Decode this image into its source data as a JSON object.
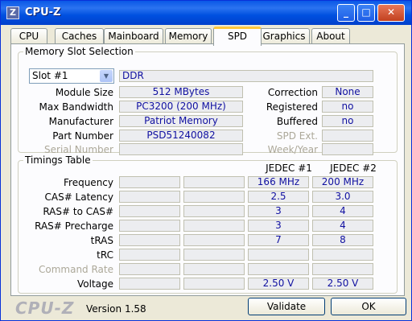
{
  "window": {
    "title": "CPU-Z",
    "app_icon_glyph": "Z"
  },
  "titlebar_buttons": {
    "minimize": "_",
    "maximize": "□",
    "close": "✕"
  },
  "tabs": [
    "CPU",
    "Caches",
    "Mainboard",
    "Memory",
    "SPD",
    "Graphics",
    "About"
  ],
  "active_tab": "SPD",
  "slot_group": {
    "title": "Memory Slot Selection",
    "slot_value": "Slot #1",
    "type_value": "DDR",
    "rows": [
      {
        "label": "Module Size",
        "value": "512 MBytes",
        "right_label": "Correction",
        "right_value": "None"
      },
      {
        "label": "Max Bandwidth",
        "value": "PC3200 (200 MHz)",
        "right_label": "Registered",
        "right_value": "no"
      },
      {
        "label": "Manufacturer",
        "value": "Patriot Memory",
        "right_label": "Buffered",
        "right_value": "no"
      },
      {
        "label": "Part Number",
        "value": "PSD51240082",
        "right_label": "SPD Ext.",
        "right_value": ""
      },
      {
        "label": "Serial Number",
        "value": "",
        "right_label": "Week/Year",
        "right_value": ""
      }
    ]
  },
  "timings_group": {
    "title": "Timings Table",
    "columns": [
      "JEDEC #1",
      "JEDEC #2"
    ],
    "rows": [
      {
        "label": "Frequency",
        "values": [
          "166 MHz",
          "200 MHz"
        ]
      },
      {
        "label": "CAS# Latency",
        "values": [
          "2.5",
          "3.0"
        ]
      },
      {
        "label": "RAS# to CAS#",
        "values": [
          "3",
          "4"
        ]
      },
      {
        "label": "RAS# Precharge",
        "values": [
          "3",
          "4"
        ]
      },
      {
        "label": "tRAS",
        "values": [
          "7",
          "8"
        ]
      },
      {
        "label": "tRC",
        "values": [
          "",
          ""
        ]
      },
      {
        "label": "Command Rate",
        "values": [
          "",
          ""
        ]
      },
      {
        "label": "Voltage",
        "values": [
          "2.50 V",
          "2.50 V"
        ]
      }
    ]
  },
  "footer": {
    "logo": "CPU-Z",
    "version": "Version 1.58",
    "validate_label": "Validate",
    "ok_label": "OK"
  },
  "colors": {
    "title_blue": "#0a58e6",
    "value_text": "#1010a0",
    "panel_bg": "#fcfcfe"
  }
}
